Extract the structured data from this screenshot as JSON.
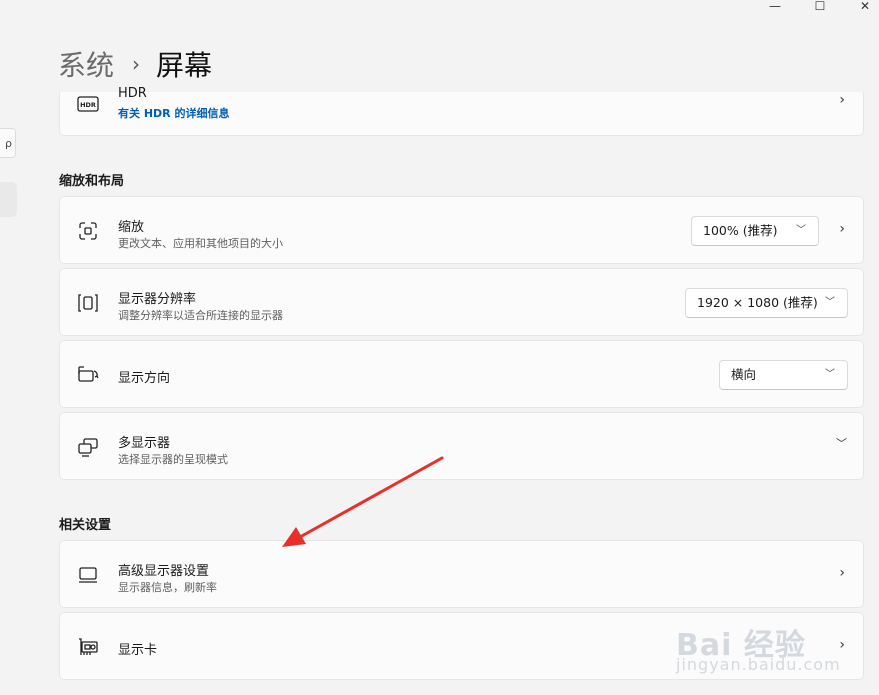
{
  "window": {
    "minimize_glyph": "—",
    "maximize_glyph": "☐",
    "close_glyph": "✕"
  },
  "left_pane": {
    "search_glyph": "ρ"
  },
  "breadcrumb": {
    "parent": "系统",
    "separator": "›",
    "current": "屏幕"
  },
  "hdr": {
    "icon_text": "HDR",
    "title": "HDR",
    "link": "有关 HDR 的详细信息"
  },
  "sections": {
    "scale_layout": "缩放和布局",
    "related": "相关设置"
  },
  "scale": {
    "title": "缩放",
    "subtitle": "更改文本、应用和其他项目的大小",
    "value": "100% (推荐)"
  },
  "resolution": {
    "title": "显示器分辨率",
    "subtitle": "调整分辨率以适合所连接的显示器",
    "value": "1920 × 1080 (推荐)"
  },
  "orientation": {
    "title": "显示方向",
    "value": "横向"
  },
  "multi": {
    "title": "多显示器",
    "subtitle": "选择显示器的呈现模式"
  },
  "advanced": {
    "title": "高级显示器设置",
    "subtitle": "显示器信息，刷新率"
  },
  "gpu": {
    "title": "显示卡"
  },
  "watermark": {
    "brand": "Bai 经验",
    "url": "jingyan.baidu.com"
  },
  "colors": {
    "accent_link": "#005fb8",
    "annotation_arrow": "#e8302a"
  }
}
